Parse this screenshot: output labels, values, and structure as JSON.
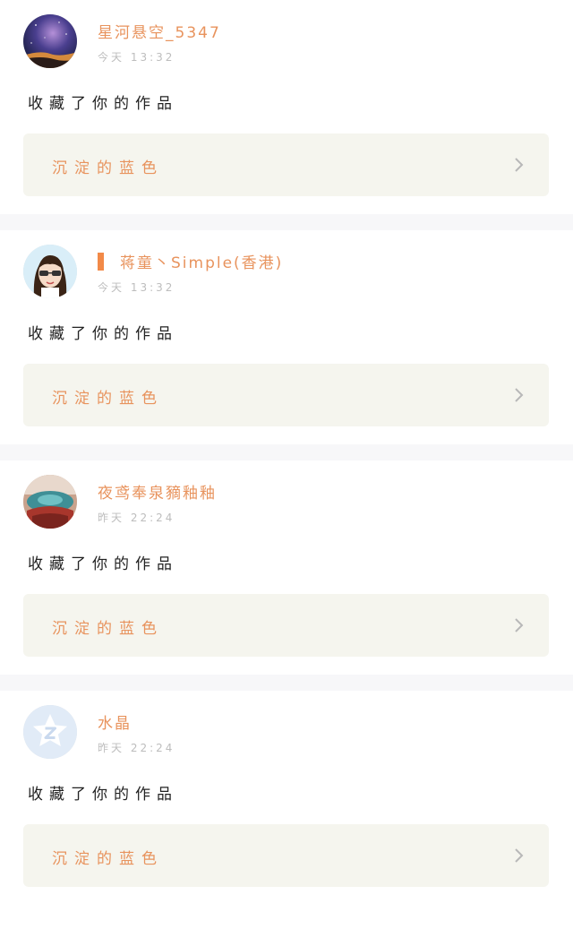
{
  "feed": {
    "items": [
      {
        "username": "星河悬空_5347",
        "time": "今天 13:32",
        "action": "收藏了你的作品",
        "work_title": "沉淀的蓝色",
        "avatar": "galaxy-night-sky"
      },
      {
        "username": "蒋童丶Simple(香港)",
        "time": "今天 13:32",
        "action": "收藏了你的作品",
        "work_title": "沉淀的蓝色",
        "avatar": "cartoon-girl-sunglasses"
      },
      {
        "username": "夜鸢奉泉豴釉釉",
        "time": "昨天 22:24",
        "action": "收藏了你的作品",
        "work_title": "沉淀的蓝色",
        "avatar": "teal-red-photo"
      },
      {
        "username": "水晶",
        "time": "昨天 22:24",
        "action": "收藏了你的作品",
        "work_title": "沉淀的蓝色",
        "avatar": "default-star-logo"
      }
    ]
  },
  "colors": {
    "accent": "#e8935d",
    "card_bg": "#f5f5ee",
    "separator": "#f7f7f9",
    "muted_text": "#bdbdbd"
  }
}
